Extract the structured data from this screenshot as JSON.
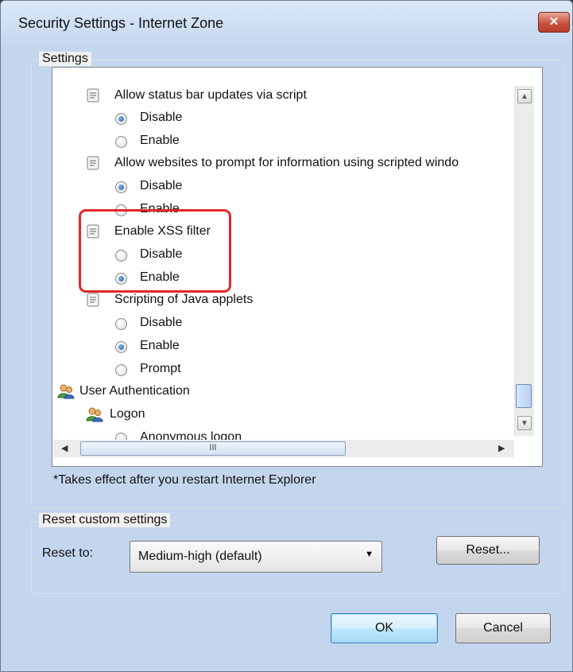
{
  "window": {
    "title": "Security Settings - Internet Zone",
    "close_label": "✕"
  },
  "settings": {
    "group_label": "Settings",
    "items": [
      {
        "icon": "script-icon",
        "label": "Allow status bar updates via script"
      },
      {
        "label": "Disable",
        "checked": true
      },
      {
        "label": "Enable",
        "checked": false
      },
      {
        "icon": "script-icon",
        "label": "Allow websites to prompt for information using scripted windo"
      },
      {
        "label": "Disable",
        "checked": true
      },
      {
        "label": "Enable",
        "checked": false
      },
      {
        "icon": "script-icon",
        "label": "Enable XSS filter"
      },
      {
        "label": "Disable",
        "checked": false
      },
      {
        "label": "Enable",
        "checked": true
      },
      {
        "icon": "script-icon",
        "label": "Scripting of Java applets"
      },
      {
        "label": "Disable",
        "checked": false
      },
      {
        "label": "Enable",
        "checked": true
      },
      {
        "label": "Prompt",
        "checked": false
      },
      {
        "icon": "users-icon",
        "label": "User Authentication"
      },
      {
        "icon": "users-icon",
        "label": "Logon"
      },
      {
        "label": "Anonymous logon",
        "checked": false
      }
    ],
    "hscroll_grip": "III",
    "footnote": "*Takes effect after you restart Internet Explorer"
  },
  "reset": {
    "group_label": "Reset custom settings",
    "reset_to_label": "Reset to:",
    "selected": "Medium-high (default)",
    "reset_button": "Reset..."
  },
  "buttons": {
    "ok": "OK",
    "cancel": "Cancel"
  },
  "colors": {
    "highlight": "#e0272a"
  }
}
